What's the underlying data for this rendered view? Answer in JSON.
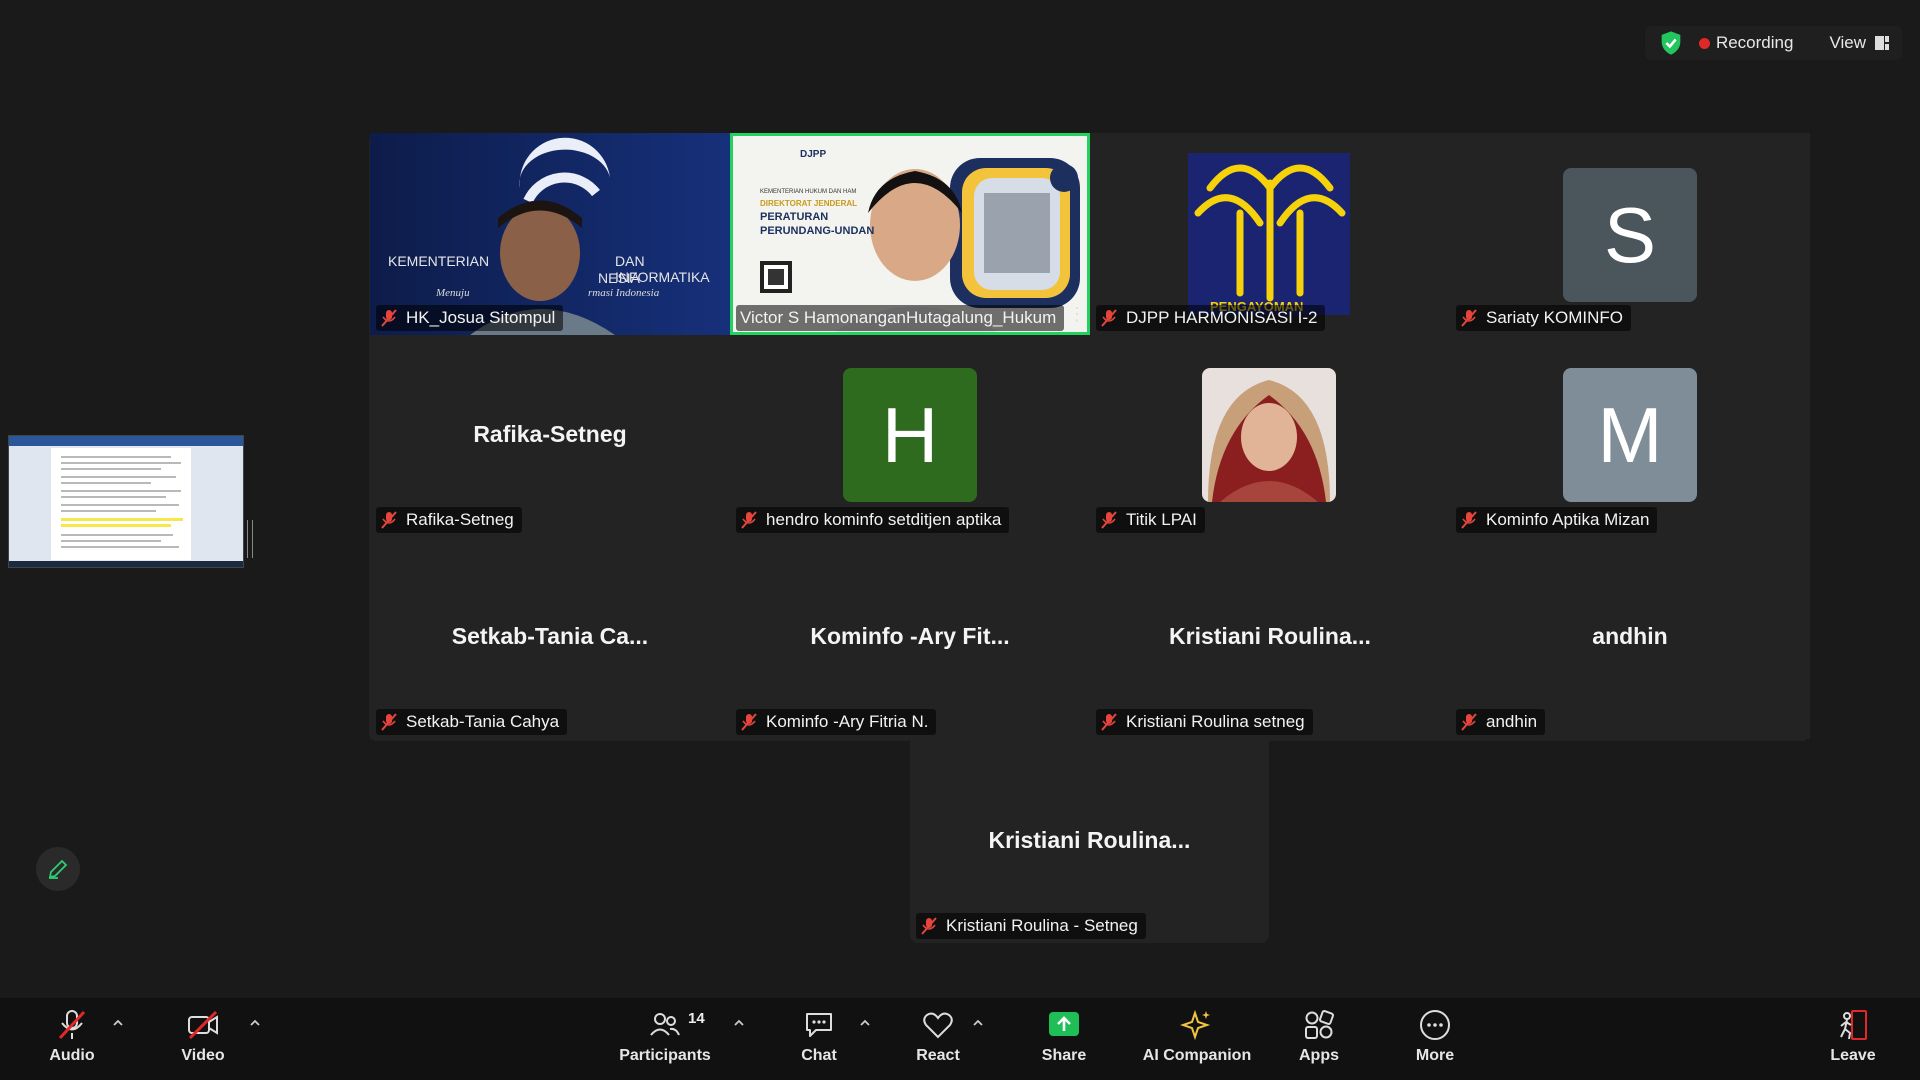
{
  "topbar": {
    "recording_label": "Recording",
    "view_label": "View"
  },
  "tiles": [
    {
      "name": "HK_Josua Sitompul",
      "kind": "video-kominfo"
    },
    {
      "name": "Victor S HamonanganHutagalung_Hukum",
      "kind": "video-djpp",
      "active": true
    },
    {
      "name": "DJPP HARMONISASI I-2",
      "kind": "logo"
    },
    {
      "name": "Sariaty KOMINFO",
      "kind": "avatar",
      "letter": "S",
      "color": "#4a555c"
    },
    {
      "name": "Rafika-Setneg",
      "kind": "text",
      "display": "Rafika-Setneg"
    },
    {
      "name": "hendro kominfo setditjen aptika",
      "kind": "avatar",
      "letter": "H",
      "color": "#2e6b1f"
    },
    {
      "name": "Titik LPAI",
      "kind": "photo"
    },
    {
      "name": "Kominfo Aptika Mizan",
      "kind": "avatar",
      "letter": "M",
      "color": "#7e8d97"
    },
    {
      "name": "Setkab-Tania Cahya",
      "kind": "text",
      "display": "Setkab-Tania Ca..."
    },
    {
      "name": "Kominfo -Ary Fitria N.",
      "kind": "text",
      "display": "Kominfo -Ary Fit..."
    },
    {
      "name": "Kristiani Roulina setneg",
      "kind": "text",
      "display": "Kristiani  Roulina..."
    },
    {
      "name": "andhin",
      "kind": "text",
      "display": "andhin"
    }
  ],
  "extra_tile": {
    "name": "Kristiani Roulina - Setneg",
    "display": "Kristiani  Roulina..."
  },
  "tile_texts": {
    "kominfo_line1": "KEMENTERIAN",
    "kominfo_line2": "DAN INFORMATIKA",
    "kominfo_line3": "NESIA",
    "kominfo_line4": "Menuju",
    "kominfo_line5": "rmasi Indonesia",
    "djpp_badge": "DJPP",
    "djpp_line1": "KEMENTERIAN HUKUM DAN HAM",
    "djpp_line2": "DIREKTORAT JENDERAL",
    "djpp_line3": "PERATURAN",
    "djpp_line4": "PERUNDANG-UNDAN",
    "logo_text": "PENGAYOMAN"
  },
  "toolbar": {
    "audio": "Audio",
    "video": "Video",
    "participants": "Participants",
    "participants_count": "14",
    "chat": "Chat",
    "react": "React",
    "share": "Share",
    "ai": "AI Companion",
    "apps": "Apps",
    "more": "More",
    "leave": "Leave"
  },
  "colors": {
    "active_border": "#23d160",
    "share_green": "#1fbf57",
    "leave_red": "#e02828",
    "muted_red": "#e5453a"
  }
}
